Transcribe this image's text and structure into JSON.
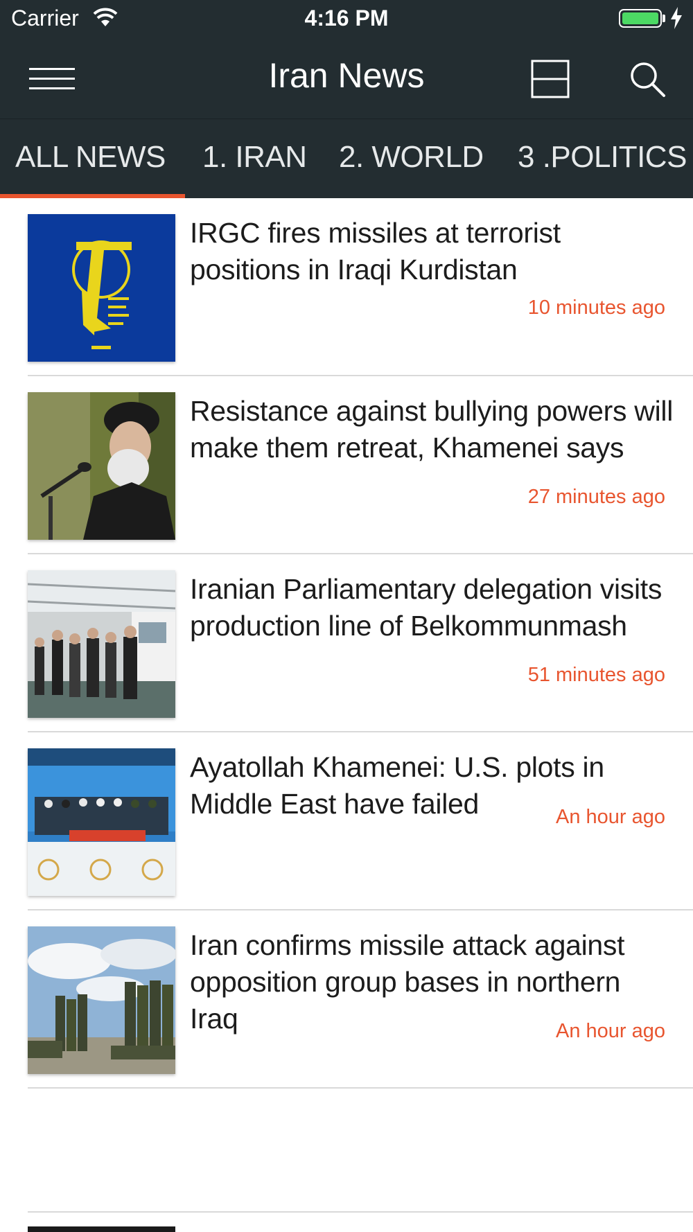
{
  "status_bar": {
    "carrier": "Carrier",
    "time": "4:16 PM",
    "battery_color": "#4cd964"
  },
  "nav": {
    "title": "Iran News",
    "menu_icon": "hamburger-menu-icon",
    "layout_icon": "split-layout-icon",
    "search_icon": "search-icon"
  },
  "tabs": [
    {
      "label": "ALL NEWS",
      "selected": true
    },
    {
      "label": "1. IRAN",
      "selected": false
    },
    {
      "label": "2. WORLD",
      "selected": false
    },
    {
      "label": "3 .POLITICS",
      "selected": false
    }
  ],
  "colors": {
    "bar_background": "#232d31",
    "accent": "#e8552f",
    "title_text": "#1c1c1c"
  },
  "news": [
    {
      "title": "IRGC fires missiles at terrorist positions in Iraqi Kurdistan",
      "time": "10 minutes ago"
    },
    {
      "title": "Resistance against bullying powers will make them retreat, Khamenei says",
      "time": "27 minutes ago"
    },
    {
      "title": "Iranian Parliamentary delegation visits production line of Belkommunmash",
      "time": "51 minutes ago"
    },
    {
      "title": "Ayatollah Khamenei: U.S. plots in Middle East have failed",
      "time": "An hour ago"
    },
    {
      "title": "Iran confirms missile attack against opposition group bases in northern Iraq",
      "time": "An hour ago"
    }
  ]
}
